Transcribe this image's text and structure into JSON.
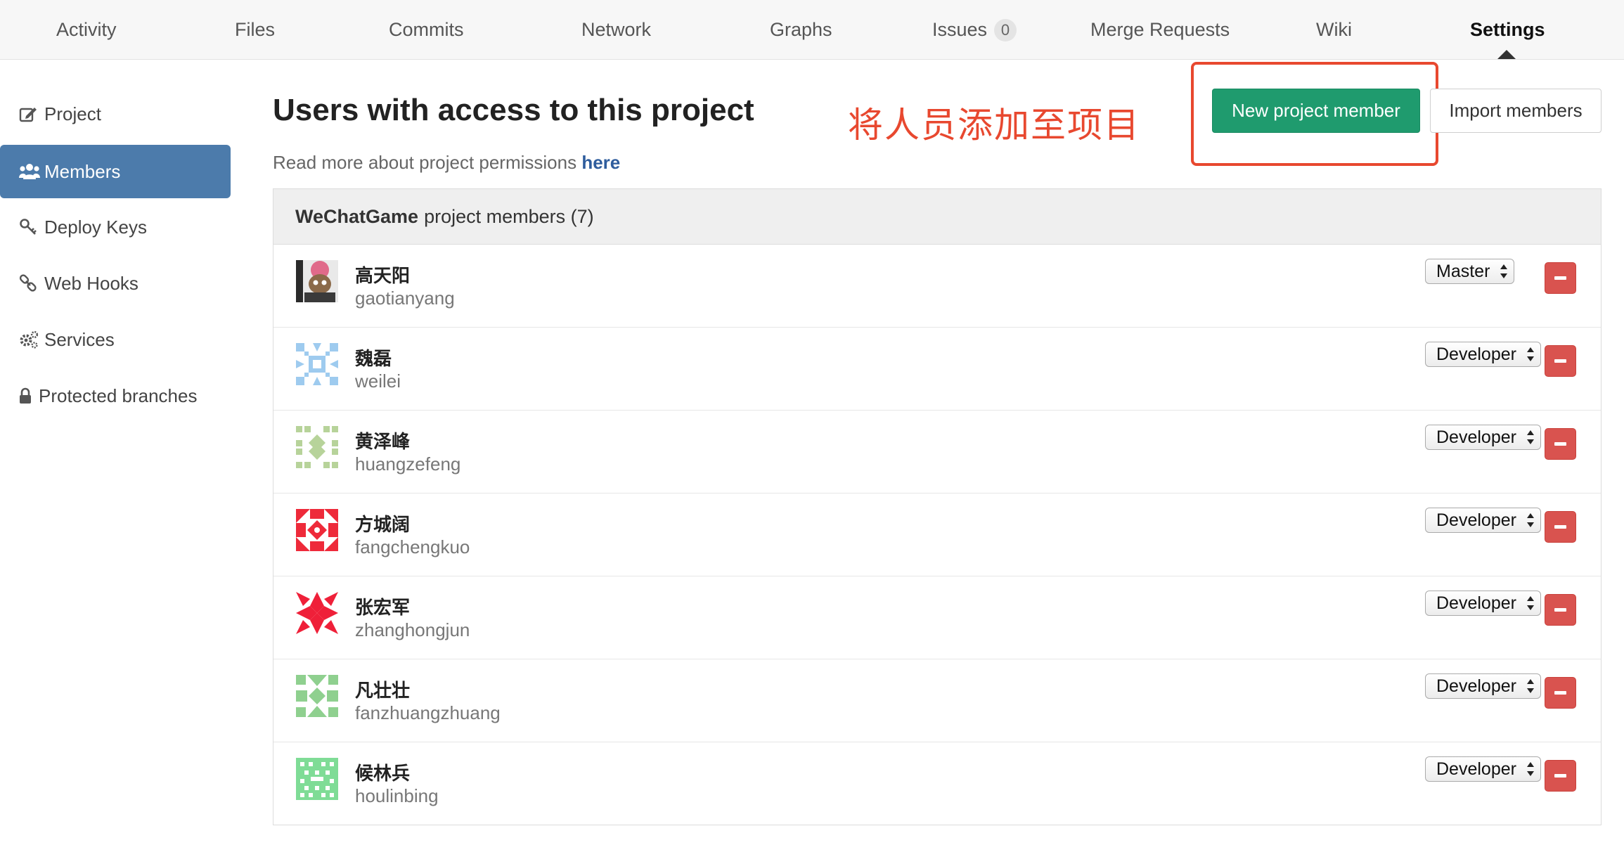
{
  "nav": {
    "tabs": [
      {
        "label": "Activity"
      },
      {
        "label": "Files"
      },
      {
        "label": "Commits"
      },
      {
        "label": "Network"
      },
      {
        "label": "Graphs"
      },
      {
        "label": "Issues",
        "count": "0"
      },
      {
        "label": "Merge Requests"
      },
      {
        "label": "Wiki"
      },
      {
        "label": "Settings",
        "active": true
      }
    ]
  },
  "sidebar": {
    "items": [
      {
        "label": "Project",
        "icon": "edit-icon"
      },
      {
        "label": "Members",
        "icon": "users-icon",
        "active": true
      },
      {
        "label": "Deploy Keys",
        "icon": "key-icon"
      },
      {
        "label": "Web Hooks",
        "icon": "link-icon"
      },
      {
        "label": "Services",
        "icon": "gears-icon"
      },
      {
        "label": "Protected branches",
        "icon": "lock-icon"
      }
    ]
  },
  "main": {
    "title": "Users with access to this project",
    "permissions_prefix": "Read more about project permissions",
    "permissions_link": "here",
    "annotation": "将人员添加至项目",
    "new_member_button": "New project member",
    "import_button": "Import members",
    "panel_project": "WeChatGame",
    "panel_suffix": "project members (7)"
  },
  "members": [
    {
      "name": "高天阳",
      "username": "gaotianyang",
      "role": "Master"
    },
    {
      "name": "魏磊",
      "username": "weilei",
      "role": "Developer"
    },
    {
      "name": "黄泽峰",
      "username": "huangzefeng",
      "role": "Developer"
    },
    {
      "name": "方城阔",
      "username": "fangchengkuo",
      "role": "Developer"
    },
    {
      "name": "张宏军",
      "username": "zhanghongjun",
      "role": "Developer"
    },
    {
      "name": "凡壮壮",
      "username": "fanzhuangzhuang",
      "role": "Developer"
    },
    {
      "name": "候林兵",
      "username": "houlinbing",
      "role": "Developer"
    }
  ],
  "colors": {
    "accent_blue": "#4c7bab",
    "success_green": "#1f9b6e",
    "danger_red": "#d9534f",
    "annotation_red": "#e8482f"
  }
}
